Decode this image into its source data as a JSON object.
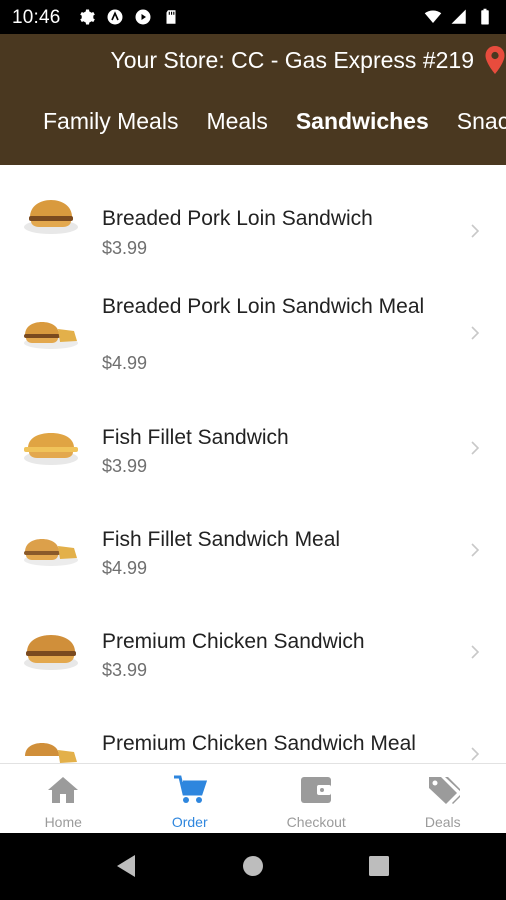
{
  "status_bar": {
    "time": "10:46",
    "left_icons": [
      "gear-icon",
      "a-circle-icon",
      "play-store-icon",
      "sd-card-icon"
    ],
    "right_icons": [
      "wifi-icon",
      "signal-icon",
      "battery-icon"
    ]
  },
  "header": {
    "store_label": "Your Store: CC - Gas Express #219",
    "pin_icon": "location-pin-icon",
    "pin_color": "#e84c3d",
    "background": "#4a3820"
  },
  "tabs": [
    {
      "label": "Family Meals",
      "active": false
    },
    {
      "label": "Meals",
      "active": false
    },
    {
      "label": "Sandwiches",
      "active": true
    },
    {
      "label": "Snacks",
      "active": false
    }
  ],
  "items": [
    {
      "name": "Breaded Pork Loin Sandwich",
      "price": "$3.99"
    },
    {
      "name": "Breaded Pork Loin Sandwich Meal",
      "price": "$4.99"
    },
    {
      "name": "Fish Fillet Sandwich",
      "price": "$3.99"
    },
    {
      "name": "Fish Fillet Sandwich Meal",
      "price": "$4.99"
    },
    {
      "name": "Premium Chicken Sandwich",
      "price": "$3.99"
    },
    {
      "name": "Premium Chicken Sandwich Meal",
      "price": ""
    }
  ],
  "bottom_nav": [
    {
      "label": "Home",
      "icon": "home-icon",
      "active": false
    },
    {
      "label": "Order",
      "icon": "cart-icon",
      "active": true
    },
    {
      "label": "Checkout",
      "icon": "wallet-icon",
      "active": false
    },
    {
      "label": "Deals",
      "icon": "tags-icon",
      "active": false
    }
  ],
  "colors": {
    "accent": "#2e86de",
    "inactive_nav": "#9b9b9b"
  }
}
